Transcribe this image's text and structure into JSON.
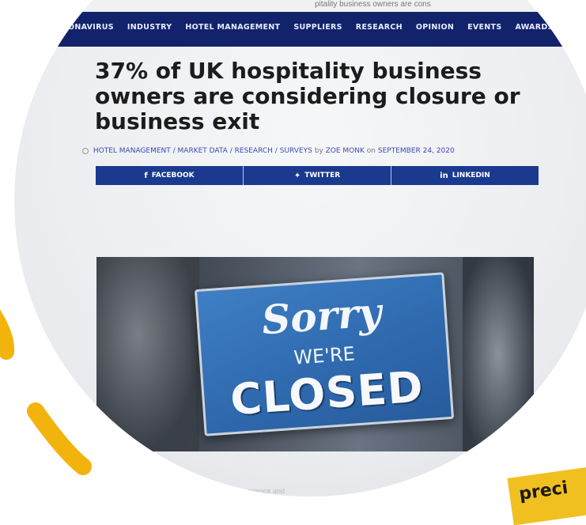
{
  "top_strip": {
    "text": "pitality business owners are cons"
  },
  "nav": {
    "items": [
      "ONAVIRUS",
      "INDUSTRY",
      "HOTEL MANAGEMENT",
      "SUPPLIERS",
      "RESEARCH",
      "OPINION",
      "EVENTS",
      "AWARDS"
    ]
  },
  "article": {
    "headline": "37% of UK hospitality business owners are considering closure or business exit",
    "categories": "HOTEL MANAGEMENT / MARKET DATA / RESEARCH / SURVEYS",
    "by": "by",
    "author": "ZOE MONK",
    "on": "on",
    "date": "SEPTEMBER 24, 2020"
  },
  "share": {
    "facebook": "FACEBOOK",
    "twitter": "TWITTER",
    "linkedin": "LINKEDIN"
  },
  "hero": {
    "sign_line1": "Sorry",
    "sign_line2": "WE'RE",
    "sign_line3": "CLOSED"
  },
  "caption": "ar experience and",
  "badge": {
    "text": "preci"
  },
  "colors": {
    "nav": "#13236b",
    "share": "#1b3a8f",
    "accent": "#f0c020"
  }
}
